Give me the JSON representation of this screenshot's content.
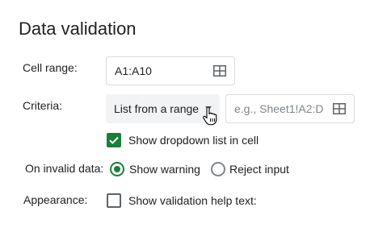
{
  "dialog": {
    "title": "Data validation"
  },
  "cell_range": {
    "label": "Cell range:",
    "value": "A1:A10",
    "icon": "grid-icon"
  },
  "criteria": {
    "label": "Criteria:",
    "selected": "List from a range",
    "range_placeholder": "e.g., Sheet1!A2:D",
    "range_icon": "grid-icon"
  },
  "show_dropdown": {
    "label": "Show dropdown list in cell",
    "checked": true
  },
  "invalid_data": {
    "label": "On invalid data:",
    "options": [
      {
        "label": "Show warning",
        "selected": true
      },
      {
        "label": "Reject input",
        "selected": false
      }
    ]
  },
  "appearance": {
    "label": "Appearance:",
    "help_text_label": "Show validation help text:",
    "checked": false
  },
  "colors": {
    "accent": "#188038",
    "text": "#202124",
    "border": "#dadce0",
    "select_bg": "#f1f3f4"
  }
}
